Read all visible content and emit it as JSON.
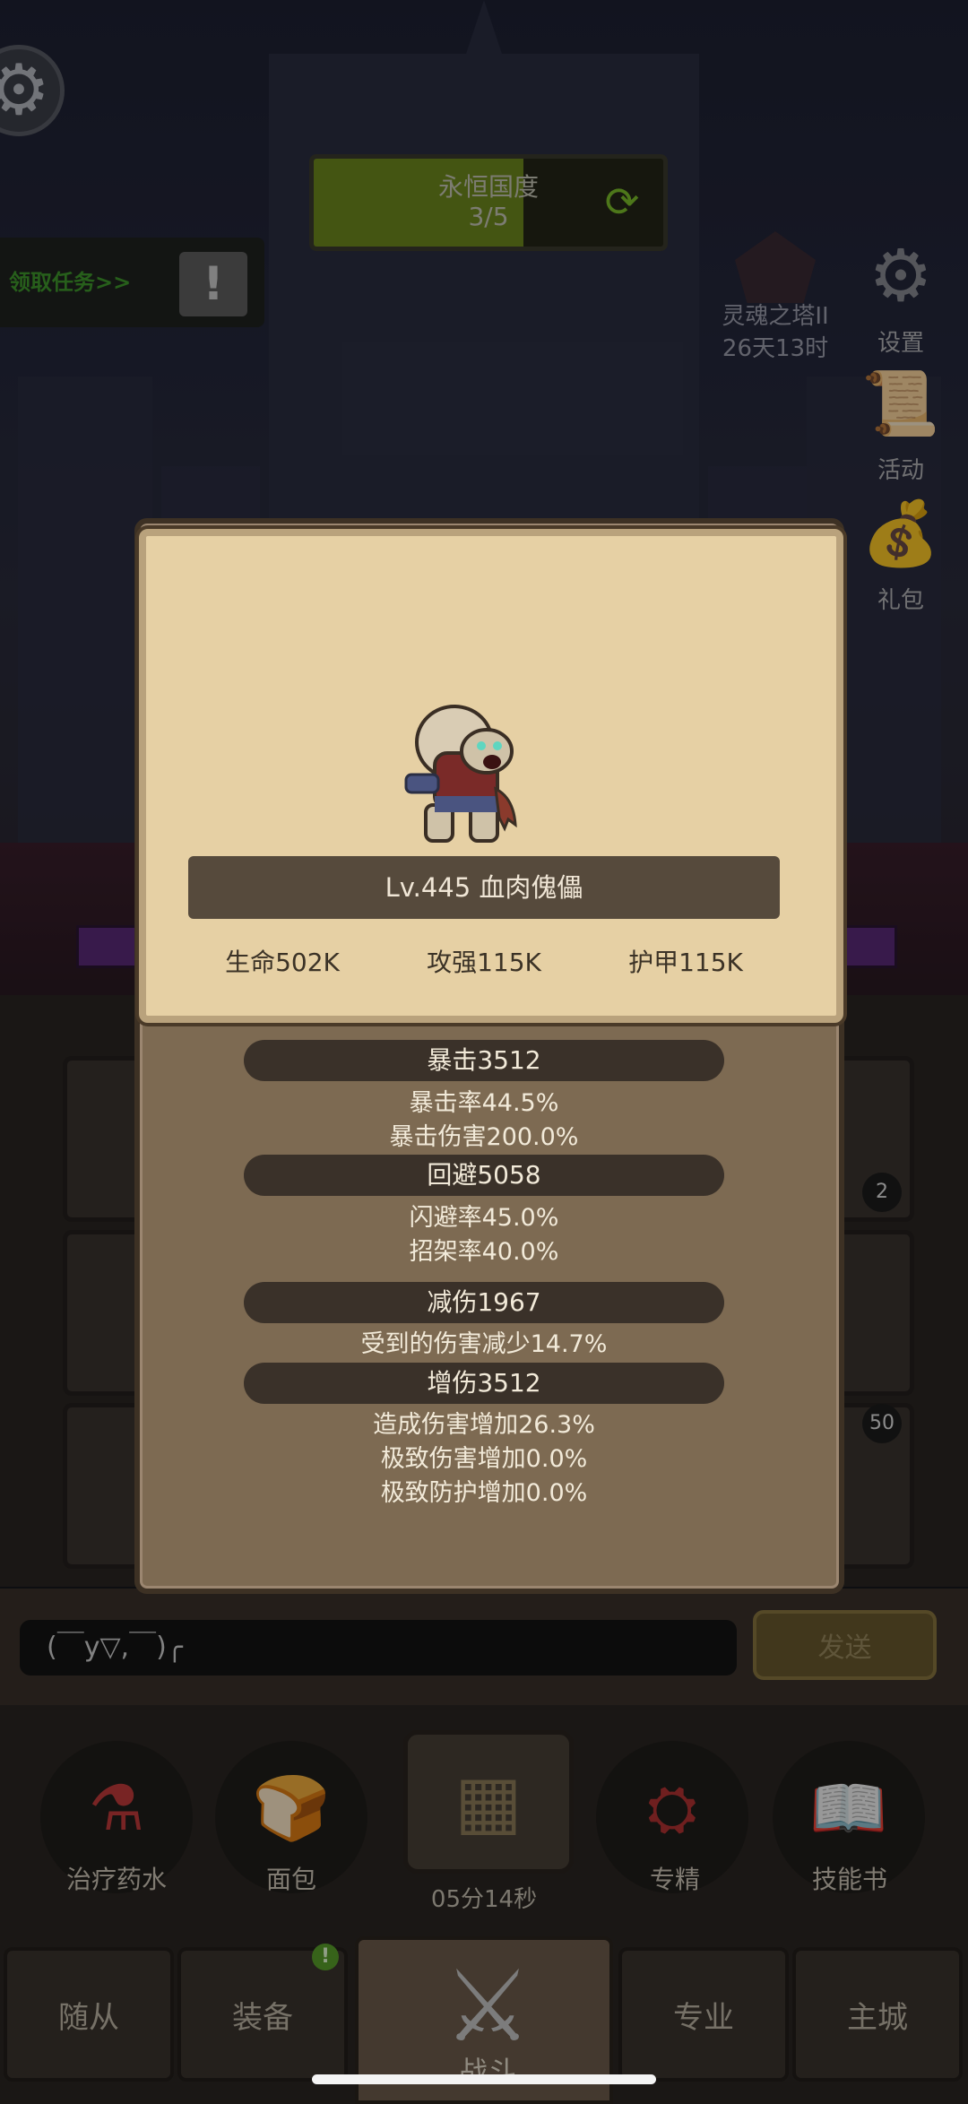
{
  "hud": {
    "eternal_country_title": "永恒国度",
    "eternal_country_progress": "3/5",
    "eternal_country_progress_fraction": 0.6,
    "quest_label": "领取任务>>",
    "quest_icon_glyph": "!",
    "soul_tower_name": "灵魂之塔II",
    "soul_tower_timer": "26天13时",
    "side_buttons": [
      {
        "label": "设置",
        "icon": "gear-icon",
        "glyph": "⚙"
      },
      {
        "label": "活动",
        "icon": "scroll-icon",
        "glyph": "📜"
      },
      {
        "label": "礼包",
        "icon": "gift-bag-icon",
        "glyph": "💰"
      }
    ],
    "gear_glyph": "⚙",
    "refresh_glyph": "⟳"
  },
  "background_slot_badges": [
    "2",
    "50"
  ],
  "monster": {
    "icon": "flesh-golem-icon",
    "name": "Lv.445 血肉傀儡",
    "hp": "生命502K",
    "attack": "攻强115K",
    "armor": "护甲115K"
  },
  "stats": {
    "crit": {
      "title": "暴击3512",
      "lines": [
        "暴击率44.5%",
        "暴击伤害200.0%"
      ]
    },
    "dodge": {
      "title": "回避5058",
      "lines": [
        "闪避率45.0%",
        "招架率40.0%"
      ]
    },
    "reduction": {
      "title": "减伤1967",
      "lines": [
        "受到的伤害减少14.7%"
      ]
    },
    "damage": {
      "title": "增伤3512",
      "lines": [
        "造成伤害增加26.3%",
        "极致伤害增加0.0%",
        "极致防护增加0.0%"
      ]
    }
  },
  "chat": {
    "input_value": "(￣y▽,￣)╭",
    "send_label": "发送"
  },
  "items": [
    {
      "label": "治疗药水",
      "icon": "health-potion-icon",
      "glyph": "⚗"
    },
    {
      "label": "面包",
      "icon": "bread-icon",
      "glyph": "🍞"
    },
    {
      "label": "专精",
      "icon": "specialization-icon",
      "glyph": "⛭"
    },
    {
      "label": "技能书",
      "icon": "skill-book-icon",
      "glyph": "📖"
    }
  ],
  "chest": {
    "icon": "treasure-chest-icon",
    "glyph": "▦",
    "timer": "05分14秒"
  },
  "nav": {
    "followers": "随从",
    "equipment": "装备",
    "battle": "战斗",
    "profession": "专业",
    "main_city": "主城",
    "battle_glyph": "⚔",
    "equipment_badge": "!"
  }
}
